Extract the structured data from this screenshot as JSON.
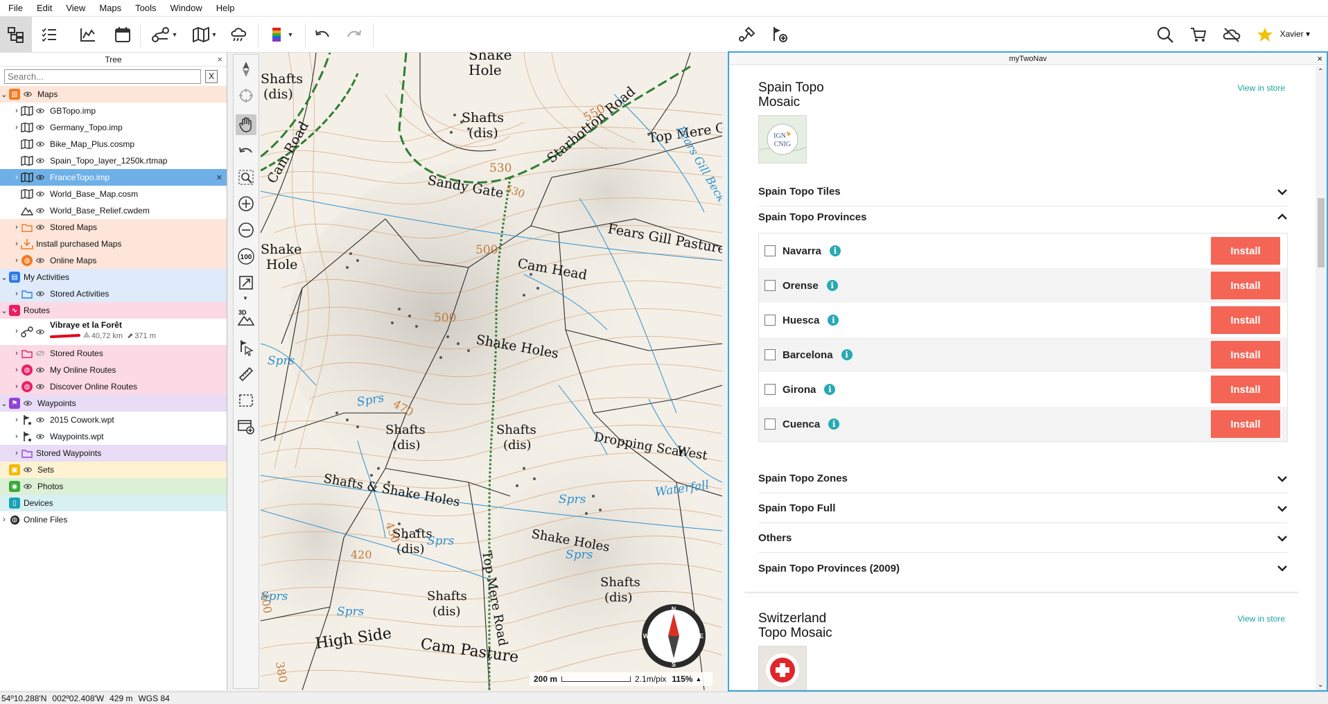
{
  "menubar": {
    "items": [
      "File",
      "Edit",
      "View",
      "Maps",
      "Tools",
      "Window",
      "Help"
    ]
  },
  "toolbar": {
    "user": "Xavier"
  },
  "tree": {
    "title": "Tree",
    "close": "×",
    "search_placeholder": "Search...",
    "search_clear": "X",
    "maps": {
      "label": "Maps",
      "items": [
        "GBTopo.imp",
        "Germany_Topo.imp",
        "Bike_Map_Plus.cosmp",
        "Spain_Topo_layer_1250k.rtmap",
        "FranceTopo.imp",
        "World_Base_Map.cosm",
        "World_Base_Relief.cwdem"
      ],
      "stored": "Stored Maps",
      "install": "Install purchased Maps",
      "online": "Online Maps"
    },
    "activities": {
      "label": "My Activities",
      "stored": "Stored Activities"
    },
    "routes": {
      "label": "Routes",
      "route_name": "Vibraye et la Forêt",
      "route_dist": "40,72 km",
      "route_elev": "371 m",
      "stored": "Stored Routes",
      "online": "My Online Routes",
      "discover": "Discover Online Routes"
    },
    "waypoints": {
      "label": "Waypoints",
      "items": [
        "2015 Cowork.wpt",
        "Waypoints.wpt"
      ],
      "stored": "Stored Waypoints"
    },
    "sets": "Sets",
    "photos": "Photos",
    "devices": "Devices",
    "online_files": "Online Files"
  },
  "map": {
    "scale_label": "200 m",
    "resolution": "2.1m/pix",
    "zoom": "115%",
    "labels": {
      "shake_holes": "Shake Holes",
      "shafts": "Shafts",
      "dis": "(dis)",
      "starbotton_road": "Starbotton Road",
      "top_mere_gate": "Top Mere Gate",
      "sandy_gate": "Sandy Gate",
      "fears_gill_pasture": "Fears Gill Pasture",
      "cam_head": "Cam Head",
      "cam_road": "Cam Road",
      "shafts_shake_holes": "Shafts & Shake Holes",
      "dropping_scar": "Dropping Scar",
      "west": "West",
      "waterfall": "Waterfall",
      "high_side": "High Side",
      "cam_pasture": "Cam Pasture",
      "top_mere_road": "Top Mere Road",
      "sprs": "Sprs",
      "fears_gill_beck": "Fears Gill Beck",
      "hole": "Hole",
      "shake": "Shake"
    },
    "contours": [
      "550",
      "530",
      "530",
      "500",
      "500",
      "470",
      "450",
      "420",
      "400",
      "380"
    ]
  },
  "panel": {
    "title": "myTwoNav",
    "close": "×",
    "spain": {
      "title_line1": "Spain Topo",
      "title_line2": "Mosaic",
      "view_store": "View in store",
      "logo_text1": "IGN",
      "logo_text2": "CNIG",
      "sections": [
        "Spain Topo Tiles",
        "Spain Topo Provinces",
        "Spain Topo Zones",
        "Spain Topo Full",
        "Others",
        "Spain Topo Provinces (2009)"
      ],
      "provinces": [
        "Navarra",
        "Orense",
        "Huesca",
        "Barcelona",
        "Girona",
        "Cuenca"
      ],
      "install_label": "Install"
    },
    "switzerland": {
      "title_line1": "Switzerland",
      "title_line2": "Topo Mosaic",
      "view_store": "View in store"
    }
  },
  "status": {
    "lat": "54º10.288'N",
    "lon": "002º02.408'W",
    "alt": "429 m",
    "datum": "WGS 84"
  },
  "colors": {
    "accent": "#3ea6d8",
    "install": "#f46556",
    "teal": "#27a9b5",
    "selected": "#6fb0e8"
  }
}
